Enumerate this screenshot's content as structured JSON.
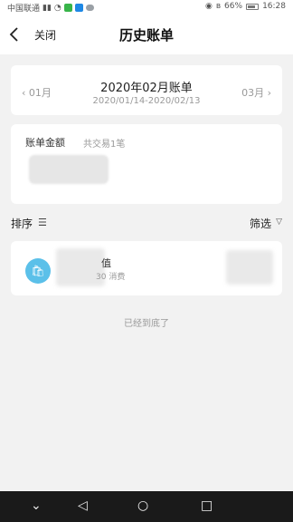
{
  "status_bar": {
    "carrier": "中国联通",
    "battery": "66%",
    "time": "16:28"
  },
  "nav": {
    "close_label": "关闭",
    "title": "历史账单",
    "back_icon": "chevron-left-icon"
  },
  "period": {
    "prev_label": "01月",
    "next_label": "03月",
    "title": "2020年02月账单",
    "range": "2020/01/14-2020/02/13"
  },
  "summary": {
    "label": "账单金额",
    "count_text": "共交易1笔"
  },
  "list_controls": {
    "sort_label": "排序",
    "sort_icon": "sort-icon",
    "filter_label": "筛选",
    "filter_icon": "filter-icon"
  },
  "transactions": [
    {
      "name": "值",
      "meta": "30 消费",
      "icon": "shopping-bag-icon"
    }
  ],
  "end_text": "已经到底了",
  "system_nav": [
    "down-icon",
    "back-triangle-icon",
    "home-circle-icon",
    "recent-square-icon"
  ],
  "colors": {
    "accent": "#5bc0e9",
    "background": "#f2f2f2"
  }
}
